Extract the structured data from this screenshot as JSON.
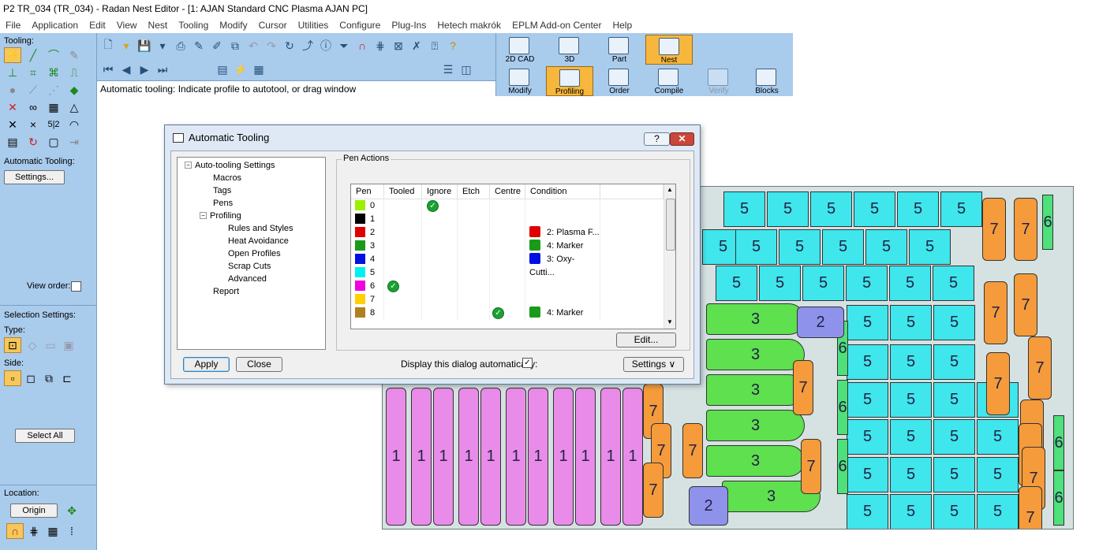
{
  "window": {
    "title": "P2 TR_034 (TR_034) - Radan Nest Editor - [1: AJAN Standard CNC Plasma AJAN PC]"
  },
  "menu": [
    "File",
    "Application",
    "Edit",
    "View",
    "Nest",
    "Tooling",
    "Modify",
    "Cursor",
    "Utilities",
    "Configure",
    "Plug-Ins",
    "Hetech makrók",
    "EPLM Add-on Center",
    "Help"
  ],
  "left_panel": {
    "tooling_label": "Tooling:",
    "auto_tooling_label": "Automatic Tooling:",
    "settings_button": "Settings...",
    "view_order_label": "View order:",
    "selection_settings_label": "Selection Settings:",
    "type_label": "Type:",
    "side_label": "Side:",
    "select_all_button": "Select All",
    "location_label": "Location:",
    "origin_button": "Origin"
  },
  "status": {
    "prompt": "Automatic tooling: Indicate profile to autotool, or drag window"
  },
  "modes": {
    "top": [
      {
        "label": "2D CAD",
        "selected": false
      },
      {
        "label": "3D",
        "selected": false
      },
      {
        "label": "Part",
        "selected": false
      },
      {
        "label": "Nest",
        "selected": true
      }
    ],
    "bottom": [
      {
        "label": "Modify",
        "selected": false,
        "disabled": false
      },
      {
        "label": "Profiling",
        "selected": true,
        "disabled": false
      },
      {
        "label": "Order",
        "selected": false,
        "disabled": false
      },
      {
        "label": "Compile",
        "selected": false,
        "disabled": false
      },
      {
        "label": "Verify",
        "selected": false,
        "disabled": true
      },
      {
        "label": "Blocks",
        "selected": false,
        "disabled": false
      }
    ]
  },
  "dialog": {
    "title": "Automatic Tooling",
    "help_label": "?",
    "close_label": "✕",
    "tree": {
      "root": "Auto-tooling Settings",
      "macros": "Macros",
      "tags": "Tags",
      "pens": "Pens",
      "profiling": "Profiling",
      "rules": "Rules and Styles",
      "heat": "Heat Avoidance",
      "open": "Open Profiles",
      "scrap": "Scrap Cuts",
      "advanced": "Advanced",
      "report": "Report"
    },
    "group_label": "Pen Actions",
    "columns": [
      "Pen",
      "Tooled",
      "Ignore",
      "Etch",
      "Centre",
      "Condition"
    ],
    "edit_button": "Edit...",
    "apply_button": "Apply",
    "close_button": "Close",
    "display_auto_label": "Display this dialog automatically:",
    "settings_button": "Settings ∨"
  },
  "pens": [
    {
      "pen": "0",
      "color": "#9cf000",
      "tooled": false,
      "ignore": true,
      "etch": false,
      "centre": false,
      "condition": "",
      "cond_color": ""
    },
    {
      "pen": "1",
      "color": "#000000",
      "tooled": false,
      "ignore": false,
      "etch": false,
      "centre": false,
      "condition": "",
      "cond_color": ""
    },
    {
      "pen": "2",
      "color": "#e00000",
      "tooled": false,
      "ignore": false,
      "etch": false,
      "centre": false,
      "condition": "2: Plasma F...",
      "cond_color": "#e00000"
    },
    {
      "pen": "3",
      "color": "#1a9a1a",
      "tooled": false,
      "ignore": false,
      "etch": false,
      "centre": false,
      "condition": "4: Marker",
      "cond_color": "#1a9a1a"
    },
    {
      "pen": "4",
      "color": "#0010e0",
      "tooled": false,
      "ignore": false,
      "etch": false,
      "centre": false,
      "condition": "3: Oxy-Cutti...",
      "cond_color": "#0010e0"
    },
    {
      "pen": "5",
      "color": "#00f0f0",
      "tooled": false,
      "ignore": false,
      "etch": false,
      "centre": false,
      "condition": "",
      "cond_color": ""
    },
    {
      "pen": "6",
      "color": "#f000e0",
      "tooled": true,
      "ignore": false,
      "etch": false,
      "centre": false,
      "condition": "",
      "cond_color": ""
    },
    {
      "pen": "7",
      "color": "#ffd000",
      "tooled": false,
      "ignore": false,
      "etch": false,
      "centre": false,
      "condition": "",
      "cond_color": ""
    },
    {
      "pen": "8",
      "color": "#b08020",
      "tooled": false,
      "ignore": false,
      "etch": false,
      "centre": true,
      "condition": "4: Marker",
      "cond_color": "#1a9a1a"
    }
  ],
  "nest_labels": {
    "five": "5",
    "seven": "7",
    "three": "3",
    "one": "1",
    "two": "2",
    "six": "6"
  },
  "colors": {
    "ribbon": "#a9cbec",
    "selected": "#f6b73c",
    "sheet": "#d6e2e2"
  }
}
